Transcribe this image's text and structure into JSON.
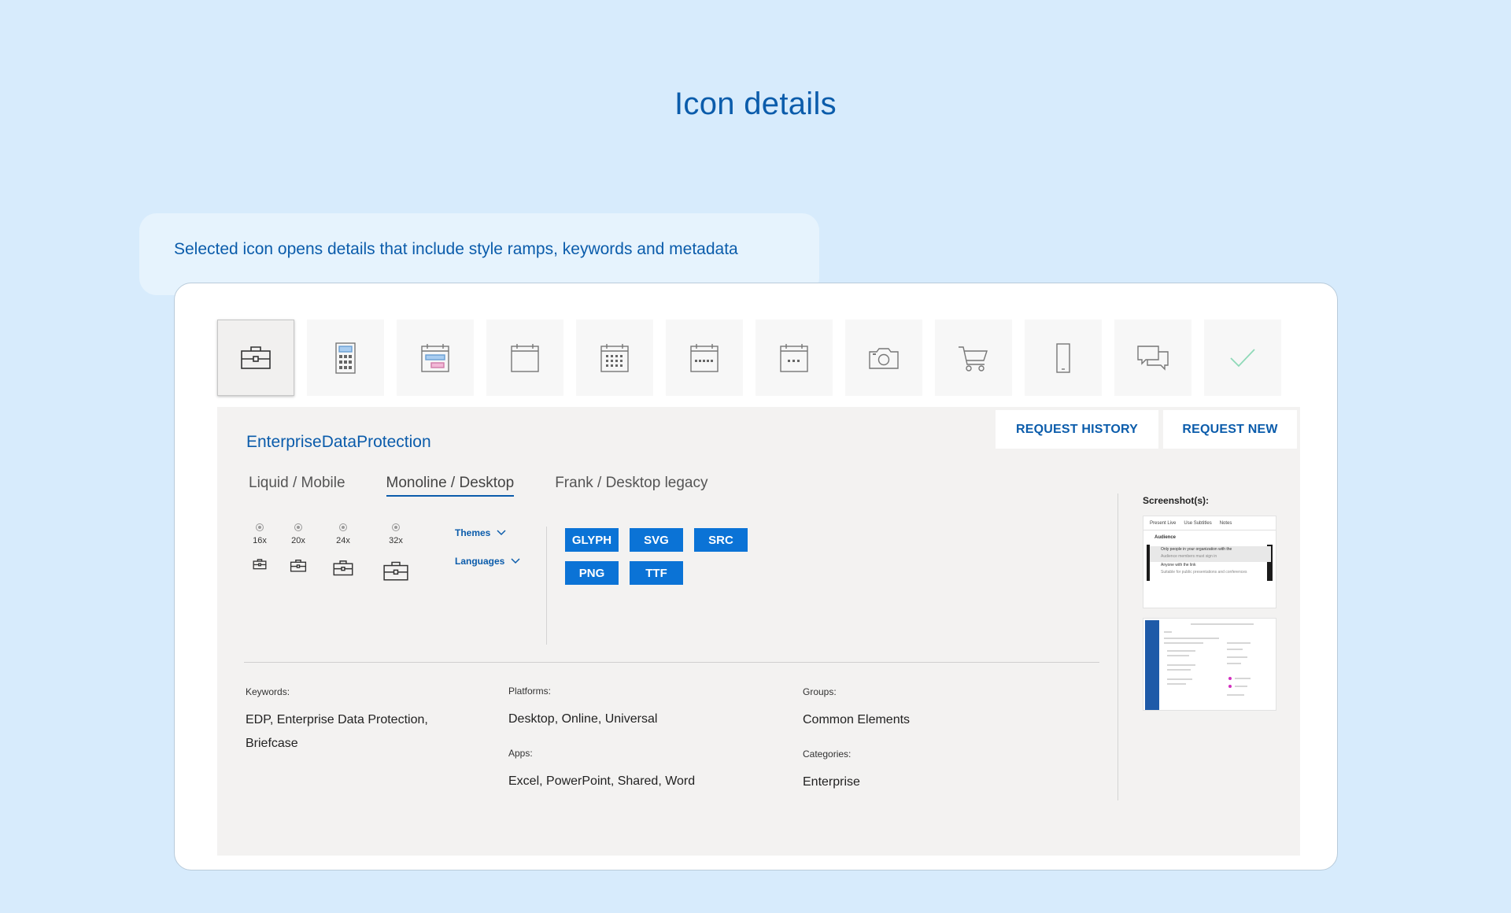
{
  "page": {
    "title": "Icon details"
  },
  "callout": {
    "text": "Selected icon opens details that include style ramps, keywords and metadata"
  },
  "icon_strip": [
    {
      "icon": "briefcase-icon",
      "selected": true
    },
    {
      "icon": "calculator-icon",
      "selected": false
    },
    {
      "icon": "calendar-colored-icon",
      "selected": false
    },
    {
      "icon": "calendar-blank-icon",
      "selected": false
    },
    {
      "icon": "calendar-month-icon",
      "selected": false
    },
    {
      "icon": "calendar-week-icon",
      "selected": false
    },
    {
      "icon": "calendar-day-icon",
      "selected": false
    },
    {
      "icon": "camera-icon",
      "selected": false
    },
    {
      "icon": "shopping-cart-icon",
      "selected": false
    },
    {
      "icon": "mobile-phone-icon",
      "selected": false
    },
    {
      "icon": "chat-bubbles-icon",
      "selected": false
    },
    {
      "icon": "checkmark-icon",
      "selected": false
    }
  ],
  "detail": {
    "icon_name": "EnterpriseDataProtection",
    "buttons": {
      "history": "REQUEST HISTORY",
      "new": "REQUEST NEW"
    },
    "style_tabs": [
      {
        "label": "Liquid / Mobile",
        "active": false
      },
      {
        "label": "Monoline / Desktop",
        "active": true
      },
      {
        "label": "Frank / Desktop legacy",
        "active": false
      }
    ],
    "sizes": [
      "16x",
      "20x",
      "24x",
      "32x"
    ],
    "dropdowns": {
      "themes": "Themes",
      "languages": "Languages"
    },
    "formats": [
      "GLYPH",
      "SVG",
      "SRC",
      "PNG",
      "TTF"
    ],
    "metadata": {
      "keywords_label": "Keywords:",
      "keywords_value": "EDP, Enterprise Data Protection, Briefcase",
      "platforms_label": "Platforms:",
      "platforms_value": "Desktop, Online, Universal",
      "apps_label": "Apps:",
      "apps_value": "Excel, PowerPoint, Shared, Word",
      "groups_label": "Groups:",
      "groups_value": "Common Elements",
      "categories_label": "Categories:",
      "categories_value": "Enterprise"
    },
    "screenshots": {
      "label": "Screenshot(s):",
      "shot1": {
        "toolbar": [
          "Present Live",
          "Use Subtitles",
          "Notes"
        ],
        "title": "Audience",
        "row1_title": "Only people in your organization with the",
        "row1_sub": "Audience members must sign in",
        "row2_title": "Anyone with the link",
        "row2_sub": "Suitable for public presentations and conferences"
      }
    }
  },
  "colors": {
    "page_bg": "#d7ebfc",
    "accent": "#0b5cab",
    "format_button": "#0b73d6",
    "panel_bg": "#f3f2f1"
  }
}
